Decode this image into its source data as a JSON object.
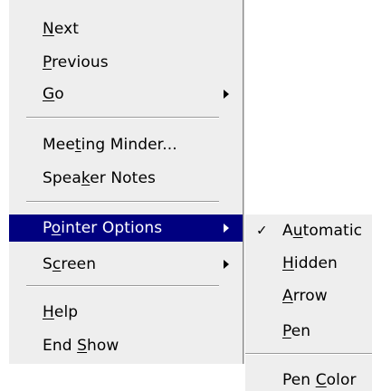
{
  "main_menu": {
    "items": [
      {
        "pre": "",
        "key": "N",
        "post": "ext"
      },
      {
        "pre": "",
        "key": "P",
        "post": "revious"
      },
      {
        "pre": "",
        "key": "G",
        "post": "o"
      },
      {
        "pre": "Mee",
        "key": "t",
        "post": "ing Minder..."
      },
      {
        "pre": "Spea",
        "key": "k",
        "post": "er Notes"
      },
      {
        "pre": "P",
        "key": "o",
        "post": "inter Options"
      },
      {
        "pre": "S",
        "key": "c",
        "post": "reen"
      },
      {
        "pre": "",
        "key": "H",
        "post": "elp"
      },
      {
        "pre": "End ",
        "key": "S",
        "post": "how"
      }
    ]
  },
  "submenu": {
    "checked_mark": "✓",
    "items": [
      {
        "pre": "A",
        "key": "u",
        "post": "tomatic"
      },
      {
        "pre": "",
        "key": "H",
        "post": "idden"
      },
      {
        "pre": "",
        "key": "A",
        "post": "rrow"
      },
      {
        "pre": "",
        "key": "P",
        "post": "en"
      },
      {
        "pre": "Pen ",
        "key": "C",
        "post": "olor"
      }
    ]
  },
  "colors": {
    "menu_background": "#eeeeee",
    "highlight": "#000080",
    "highlight_text": "#ffffff"
  }
}
